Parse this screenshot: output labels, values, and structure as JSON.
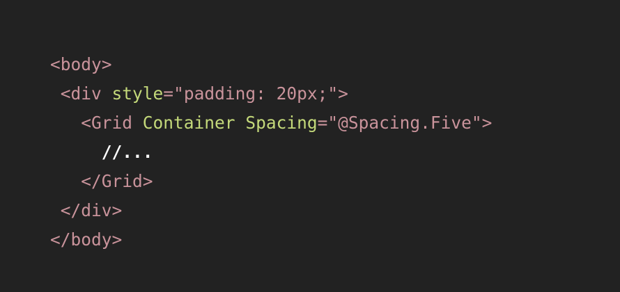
{
  "colors": {
    "background": "#222222",
    "tag": "#c9939b",
    "attr": "#c4d97a",
    "string": "#c9939b",
    "comment": "#ffffff"
  },
  "lines": [
    {
      "indent": "",
      "tokens": [
        {
          "type": "tag",
          "text": "<body>"
        }
      ]
    },
    {
      "indent": " ",
      "tokens": [
        {
          "type": "tag",
          "text": "<div "
        },
        {
          "type": "attr",
          "text": "style"
        },
        {
          "type": "tag",
          "text": "="
        },
        {
          "type": "str",
          "text": "\"padding: 20px;\""
        },
        {
          "type": "tag",
          "text": ">"
        }
      ]
    },
    {
      "indent": "   ",
      "tokens": [
        {
          "type": "tag",
          "text": "<Grid "
        },
        {
          "type": "attr",
          "text": "Container"
        },
        {
          "type": "tag",
          "text": " "
        },
        {
          "type": "attr",
          "text": "Spacing"
        },
        {
          "type": "tag",
          "text": "="
        },
        {
          "type": "str",
          "text": "\"@Spacing.Five\""
        },
        {
          "type": "tag",
          "text": ">"
        }
      ]
    },
    {
      "indent": "     ",
      "tokens": [
        {
          "type": "comment",
          "text": "//..."
        }
      ]
    },
    {
      "indent": "   ",
      "tokens": [
        {
          "type": "tag",
          "text": "</Grid>"
        }
      ]
    },
    {
      "indent": " ",
      "tokens": [
        {
          "type": "tag",
          "text": "</div>"
        }
      ]
    },
    {
      "indent": "",
      "tokens": [
        {
          "type": "tag",
          "text": "</body>"
        }
      ]
    }
  ]
}
